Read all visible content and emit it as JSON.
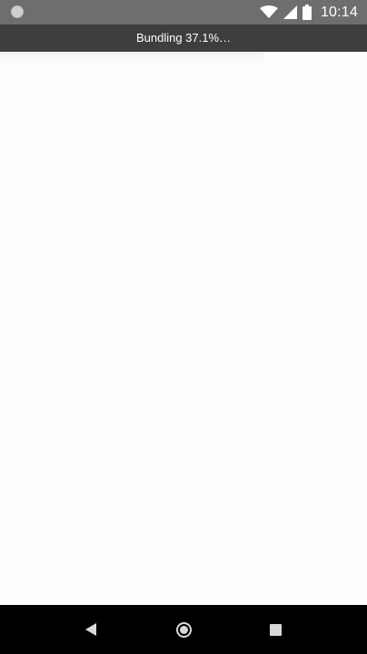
{
  "status_bar": {
    "time": "10:14",
    "icons": [
      "notification-dot-icon",
      "wifi-icon",
      "signal-icon",
      "battery-icon"
    ]
  },
  "banner": {
    "text": "Bundling 37.1%…",
    "progress_percent": 37.1
  },
  "navigation_bar": {
    "buttons": [
      "back-icon",
      "home-icon",
      "recents-icon"
    ]
  },
  "colors": {
    "status_bar_bg": "#6e6e6e",
    "banner_bg": "#3e3e3e",
    "content_bg": "#fdfdfd",
    "nav_bar_bg": "#000000"
  }
}
